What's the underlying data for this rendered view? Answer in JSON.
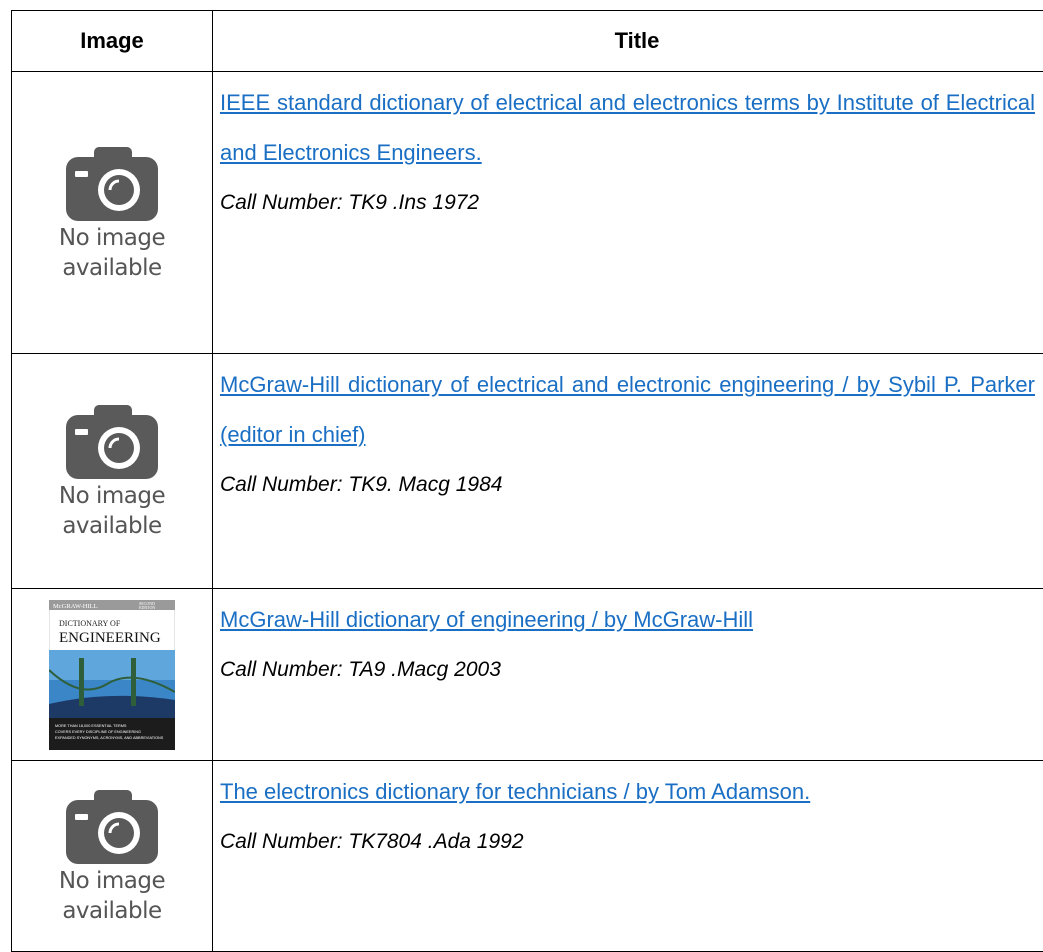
{
  "table": {
    "headers": {
      "image": "Image",
      "title": "Title"
    },
    "rows": [
      {
        "image": {
          "icon": "camera-icon",
          "caption_line1": "No image",
          "caption_line2": "available"
        },
        "title": "IEEE standard dictionary of electrical and electronics terms by Institute of Electrical and Electronics Engineers.",
        "call_number": "Call Number: TK9  .Ins 1972"
      },
      {
        "image": {
          "icon": "camera-icon",
          "caption_line1": "No image",
          "caption_line2": "available"
        },
        "title": "McGraw-Hill dictionary of electrical and electronic engineering / by Sybil P. Parker (editor in chief)",
        "call_number": "Call Number: TK9. Macg 1984"
      },
      {
        "image": {
          "type": "book-cover",
          "publisher": "McGRAW-HILL",
          "edition_line1": "SECOND",
          "edition_line2": "EDITION",
          "title_line1": "DICTIONARY OF",
          "title_line2": "ENGINEERING",
          "blurb_line1": "MORE THAN 18,000 ESSENTIAL TERMS",
          "blurb_line2": "COVERS EVERY DISCIPLINE OF ENGINEERING",
          "blurb_line3": "EXPANDED SYNONYMS, ACRONYMS, AND ABBREVIATIONS"
        },
        "title": "McGraw-Hill dictionary of engineering / by McGraw-Hill",
        "call_number": "Call Number: TA9 .Macg 2003"
      },
      {
        "image": {
          "icon": "camera-icon",
          "caption_line1": "No image",
          "caption_line2": "available"
        },
        "title": "The electronics dictionary for technicians / by Tom Adamson.",
        "call_number": "Call Number: TK7804 .Ada 1992"
      }
    ]
  },
  "colors": {
    "link": "#1a6fc4",
    "icon": "#5a5a5a",
    "caption": "#555555",
    "border": "#000000"
  }
}
